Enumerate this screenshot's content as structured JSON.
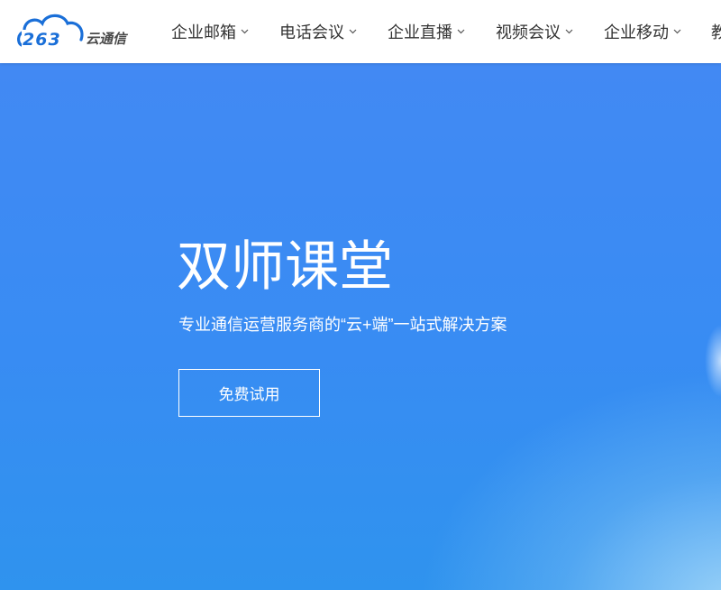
{
  "header": {
    "logo": {
      "number": "263",
      "name": "云通信",
      "icon": "cloud-logo-icon"
    },
    "nav": [
      {
        "label": "企业邮箱",
        "icon": "chevron-down-icon"
      },
      {
        "label": "电话会议",
        "icon": "chevron-down-icon"
      },
      {
        "label": "企业直播",
        "icon": "chevron-down-icon"
      },
      {
        "label": "视频会议",
        "icon": "chevron-down-icon"
      },
      {
        "label": "企业移动",
        "icon": "chevron-down-icon"
      },
      {
        "label": "教"
      }
    ]
  },
  "hero": {
    "title": "双师课堂",
    "subtitle": "专业通信运营服务商的“云+端”一站式解决方案",
    "cta": "免费试用"
  },
  "colors": {
    "brand": "#1a6fd8",
    "nav_text": "#333333",
    "hero_top": "#4289f3",
    "hero_bottom_right": "#7cc0f2",
    "hero_text": "#ffffff"
  }
}
